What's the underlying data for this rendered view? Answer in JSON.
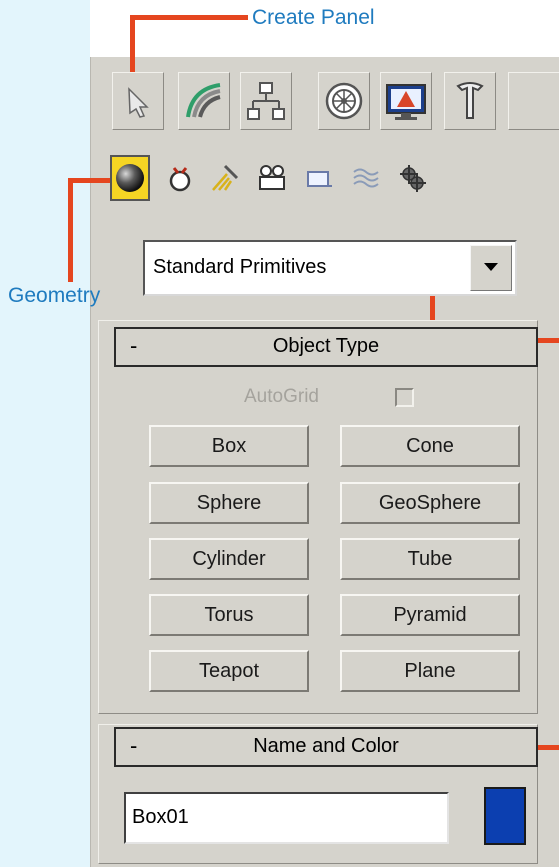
{
  "callouts": {
    "create_panel": "Create Panel",
    "geometry": "Geometry"
  },
  "command_tabs": [
    "create-icon",
    "modify-icon",
    "hierarchy-icon",
    "motion-icon",
    "display-icon",
    "utilities-icon"
  ],
  "categories": [
    "geometry-icon",
    "shapes-icon",
    "lights-icon",
    "cameras-icon",
    "helpers-icon",
    "space-warps-icon",
    "systems-icon"
  ],
  "dropdown": {
    "value": "Standard Primitives"
  },
  "object_type": {
    "title": "Object Type",
    "collapse": "-",
    "autogrid_label": "AutoGrid",
    "buttons": [
      "Box",
      "Cone",
      "Sphere",
      "GeoSphere",
      "Cylinder",
      "Tube",
      "Torus",
      "Pyramid",
      "Teapot",
      "Plane"
    ]
  },
  "name_and_color": {
    "title": "Name and Color",
    "collapse": "-",
    "name_value": "Box01",
    "color": "#0c3fb0"
  },
  "colors": {
    "callout_text": "#1f7bbf",
    "callout_line": "#e5461f",
    "panel_bg": "#d5d3cc"
  }
}
